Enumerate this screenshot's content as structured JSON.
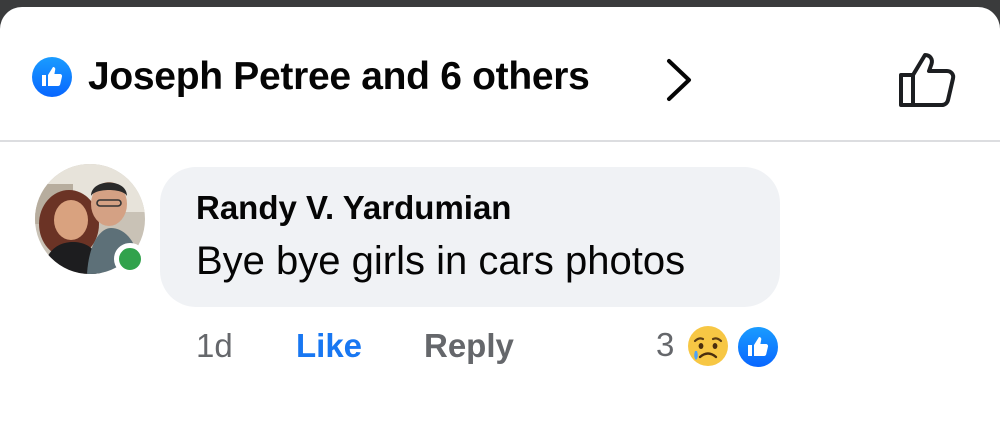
{
  "reactions": {
    "summary": "Joseph Petree and 6 others",
    "icon": "like-reaction-icon",
    "accent": "#0866ff"
  },
  "comment": {
    "author": "Randy V. Yardumian",
    "text": "Bye bye girls in cars photos",
    "online": true,
    "online_color": "#31a24c",
    "bubble_color": "#f0f2f5"
  },
  "actions": {
    "timestamp": "1d",
    "like_label": "Like",
    "reply_label": "Reply",
    "like_color": "#1877f2"
  },
  "comment_reactions": {
    "count": "3",
    "types": [
      "sad-reaction-icon",
      "like-reaction-icon"
    ]
  }
}
